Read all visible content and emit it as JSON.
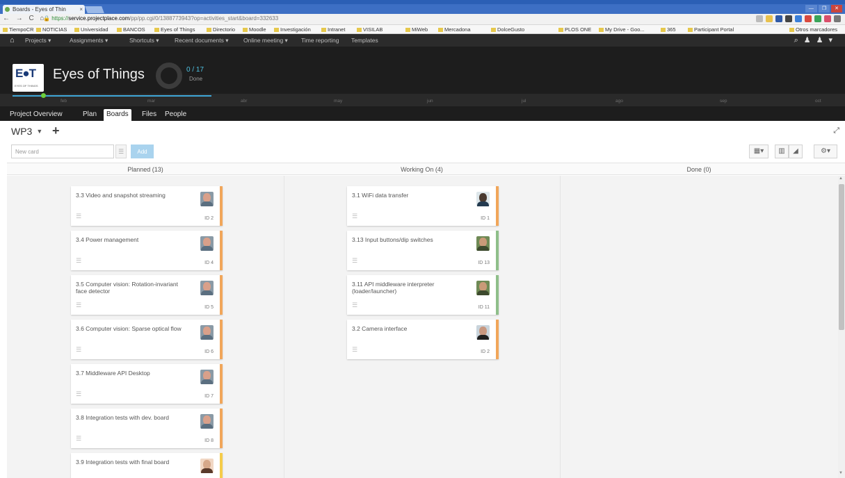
{
  "browser": {
    "tab_title": "Boards - Eyes of Thin",
    "url_scheme": "https://",
    "url_host": "service.projectplace.com",
    "url_path": "/pp/pp.cgi/0/1388773943?op=activities_start&board=332633",
    "bookmarks": [
      "TiempoCR",
      "NOTICIAS",
      "Universidad",
      "BANCOS",
      "Eyes of Things",
      "Directorio",
      "Moodle",
      "Investigación",
      "Intranet",
      "VISILAB",
      "MiWeb",
      "Mercadona",
      "DolceGusto",
      "PLOS ONE",
      "My Drive - Goo...",
      "365",
      "Participant Portal",
      "Otros marcadores"
    ]
  },
  "appmenu": {
    "items": [
      "Projects ▾",
      "Assignments ▾",
      "Shortcuts ▾",
      "Recent documents ▾",
      "Online meeting ▾",
      "Time reporting",
      "Templates"
    ]
  },
  "project": {
    "name": "Eyes of Things",
    "logo_text": "E●T",
    "logo_sub": "EYES OF THINGS",
    "done_count": "0 / 17",
    "done_label": "Done",
    "months": [
      "feb",
      "mar",
      "abr",
      "may",
      "jun",
      "jul",
      "ago",
      "sep",
      "oct"
    ]
  },
  "tabs": [
    "Project Overview",
    "Plan",
    "Boards",
    "Files",
    "People"
  ],
  "board": {
    "name": "WP3",
    "new_card_placeholder": "New card",
    "add_label": "Add"
  },
  "columns": [
    {
      "title": "Planned (13)",
      "cards": [
        {
          "title": "3.3 Video and snapshot streaming",
          "id": "ID 2",
          "color": "#f1a65a",
          "avatar": "man-a"
        },
        {
          "title": "3.4 Power management",
          "id": "ID 4",
          "color": "#f1a65a",
          "avatar": "man-a"
        },
        {
          "title": "3.5 Computer vision: Rotation-invariant face detector",
          "id": "ID 5",
          "color": "#f1a65a",
          "avatar": "man-a"
        },
        {
          "title": "3.6 Computer vision: Sparse optical flow",
          "id": "ID 6",
          "color": "#f1a65a",
          "avatar": "man-a"
        },
        {
          "title": "3.7 Middleware API Desktop",
          "id": "ID 7",
          "color": "#f1a65a",
          "avatar": "man-a"
        },
        {
          "title": "3.8 Integration tests with dev. board",
          "id": "ID 8",
          "color": "#f1a65a",
          "avatar": "man-a"
        },
        {
          "title": "3.9 Integration tests with final board",
          "id": "",
          "color": "#f5cc4a",
          "avatar": "woman-a"
        }
      ]
    },
    {
      "title": "Working On (4)",
      "cards": [
        {
          "title": "3.1 WiFi data transfer",
          "id": "ID 1",
          "color": "#f1a65a",
          "avatar": "man-b"
        },
        {
          "title": "3.13 Input buttons/dip switches",
          "id": "ID 13",
          "color": "#8fbf8a",
          "avatar": "man-c"
        },
        {
          "title": "3.11 API middleware interpreter (loader/launcher)",
          "id": "ID 11",
          "color": "#8fbf8a",
          "avatar": "man-c"
        },
        {
          "title": "3.2 Camera interface",
          "id": "ID 2",
          "color": "#f1a65a",
          "avatar": "woman-b"
        }
      ]
    },
    {
      "title": "Done (0)",
      "cards": []
    }
  ]
}
